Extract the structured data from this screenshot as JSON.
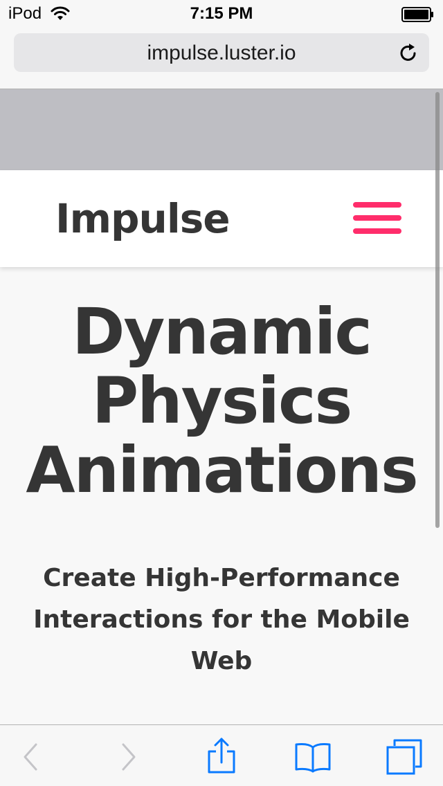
{
  "status_bar": {
    "carrier": "iPod",
    "time": "7:15 PM"
  },
  "browser": {
    "url": "impulse.luster.io"
  },
  "site": {
    "logo": "Impulse",
    "accent_color": "#ff2d6b"
  },
  "hero": {
    "title_lines": [
      "Dynamic",
      "Physics",
      "Animations"
    ],
    "subtitle": "Create High-Performance Interactions for the Mobile Web"
  },
  "colors": {
    "ios_blue": "#0a7aff",
    "disabled_gray": "#c4c4c8",
    "text_dark": "#353535"
  },
  "icons": {
    "wifi": "wifi-icon",
    "battery": "battery-icon",
    "reload": "reload-icon",
    "back": "back-chevron-icon",
    "forward": "forward-chevron-icon",
    "share": "share-icon",
    "bookmarks": "bookmarks-icon",
    "tabs": "tabs-icon",
    "menu": "hamburger-menu-icon"
  }
}
